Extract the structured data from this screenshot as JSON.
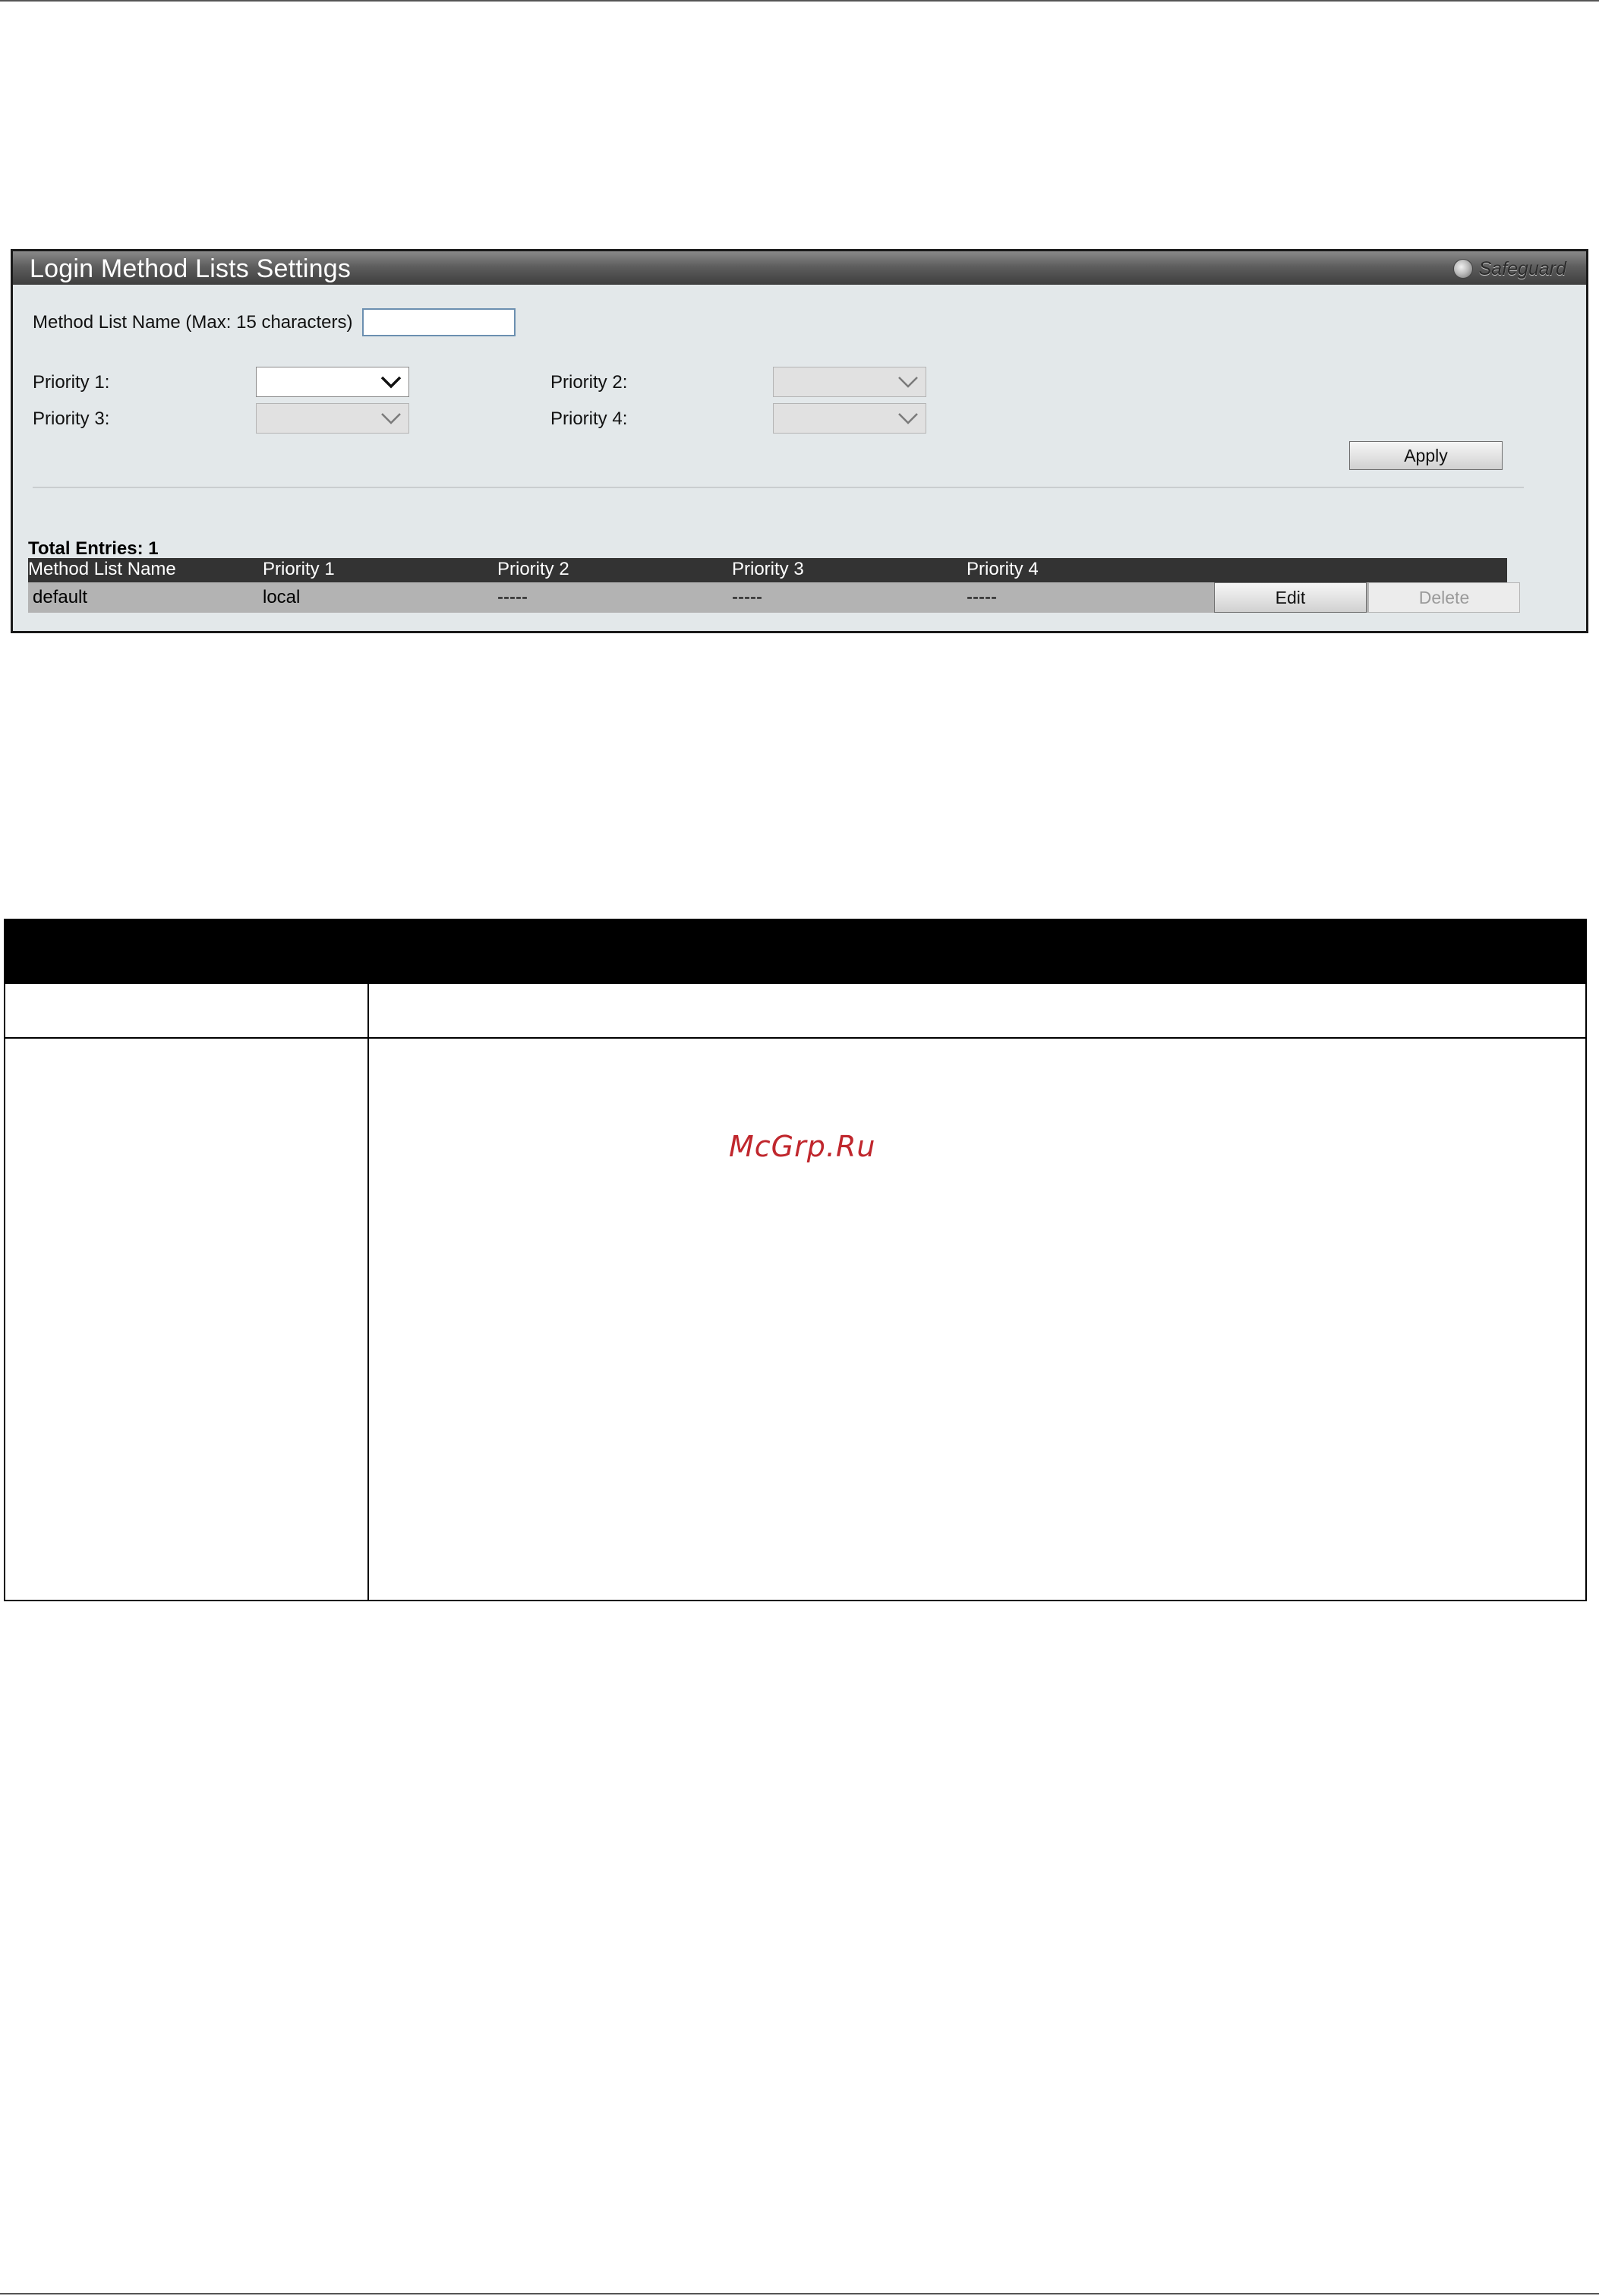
{
  "panel": {
    "title": "Login Method Lists Settings",
    "safeguard_label": "Safeguard"
  },
  "form": {
    "method_list_name_label": "Method List Name (Max: 15 characters)",
    "method_list_name_value": "",
    "priority1_label": "Priority 1:",
    "priority2_label": "Priority 2:",
    "priority3_label": "Priority 3:",
    "priority4_label": "Priority 4:",
    "priority1_value": "",
    "priority2_value": "",
    "priority3_value": "",
    "priority4_value": "",
    "apply_label": "Apply"
  },
  "entries": {
    "total_label": "Total Entries: 1",
    "columns": [
      "Method List Name",
      "Priority 1",
      "Priority 2",
      "Priority 3",
      "Priority 4"
    ],
    "rows": [
      {
        "name": "default",
        "p1": "local",
        "p2": "-----",
        "p3": "-----",
        "p4": "-----",
        "edit_label": "Edit",
        "delete_label": "Delete"
      }
    ]
  },
  "watermark": "McGrp.Ru",
  "icons": {
    "safeguard": "safeguard-indicator-icon",
    "dropdown": "chevron-down-icon"
  }
}
